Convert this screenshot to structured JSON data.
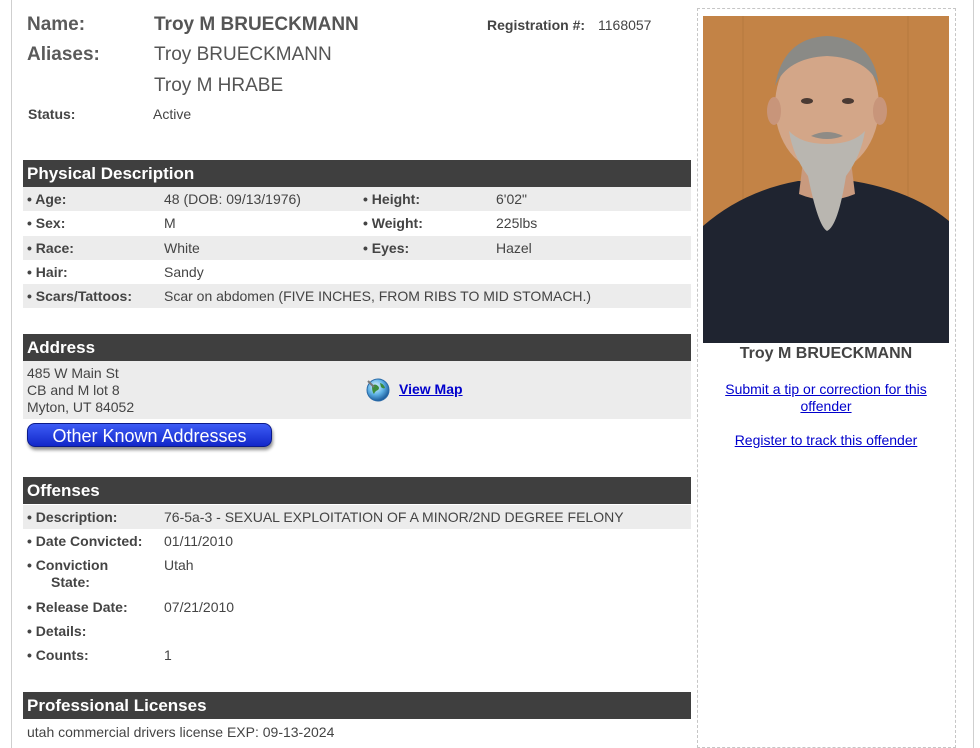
{
  "identity": {
    "name_label": "Name:",
    "name_value": "Troy M BRUECKMANN",
    "aliases_label": "Aliases:",
    "aliases": [
      "Troy BRUECKMANN",
      "Troy M HRABE"
    ],
    "status_label": "Status:",
    "status_value": "Active",
    "registration_label": "Registration #:",
    "registration_value": "1168057"
  },
  "physical": {
    "heading": "Physical Description",
    "rows": [
      {
        "l1": "• Age:",
        "v1": "48  (DOB: 09/13/1976)",
        "l2": "• Height:",
        "v2": "6'02\""
      },
      {
        "l1": "• Sex:",
        "v1": "M",
        "l2": "• Weight:",
        "v2": "225lbs"
      },
      {
        "l1": "• Race:",
        "v1": "White",
        "l2": "• Eyes:",
        "v2": "Hazel"
      },
      {
        "l1": "• Hair:",
        "v1": "Sandy",
        "l2": "",
        "v2": ""
      },
      {
        "l1": "• Scars/Tattoos:",
        "v1": "Scar on abdomen (FIVE INCHES, FROM RIBS TO MID STOMACH.)",
        "l2": "",
        "v2": ""
      }
    ]
  },
  "address": {
    "heading": "Address",
    "lines": [
      "485 W Main St",
      "CB and M lot 8",
      "Myton, UT 84052"
    ],
    "map_link": "View Map",
    "other_button": "Other Known Addresses"
  },
  "offenses": {
    "heading": "Offenses",
    "rows": [
      {
        "label": "• Description:",
        "value": "76-5a-3 - SEXUAL EXPLOITATION OF A MINOR/2ND DEGREE FELONY"
      },
      {
        "label": "• Date Convicted:",
        "value": "01/11/2010"
      },
      {
        "label_line1": "• Conviction",
        "label_line2": "State:",
        "value": "Utah"
      },
      {
        "label": "• Release Date:",
        "value": "07/21/2010"
      },
      {
        "label": "• Details:",
        "value": ""
      },
      {
        "label": "• Counts:",
        "value": "1"
      }
    ]
  },
  "licenses": {
    "heading": "Professional Licenses",
    "text": "utah commercial drivers license EXP: 09-13-2024"
  },
  "sidebar": {
    "photo_caption": "Troy M BRUECKMANN",
    "tip_link": "Submit a tip or correction for this offender",
    "track_link": "Register to track this offender"
  }
}
